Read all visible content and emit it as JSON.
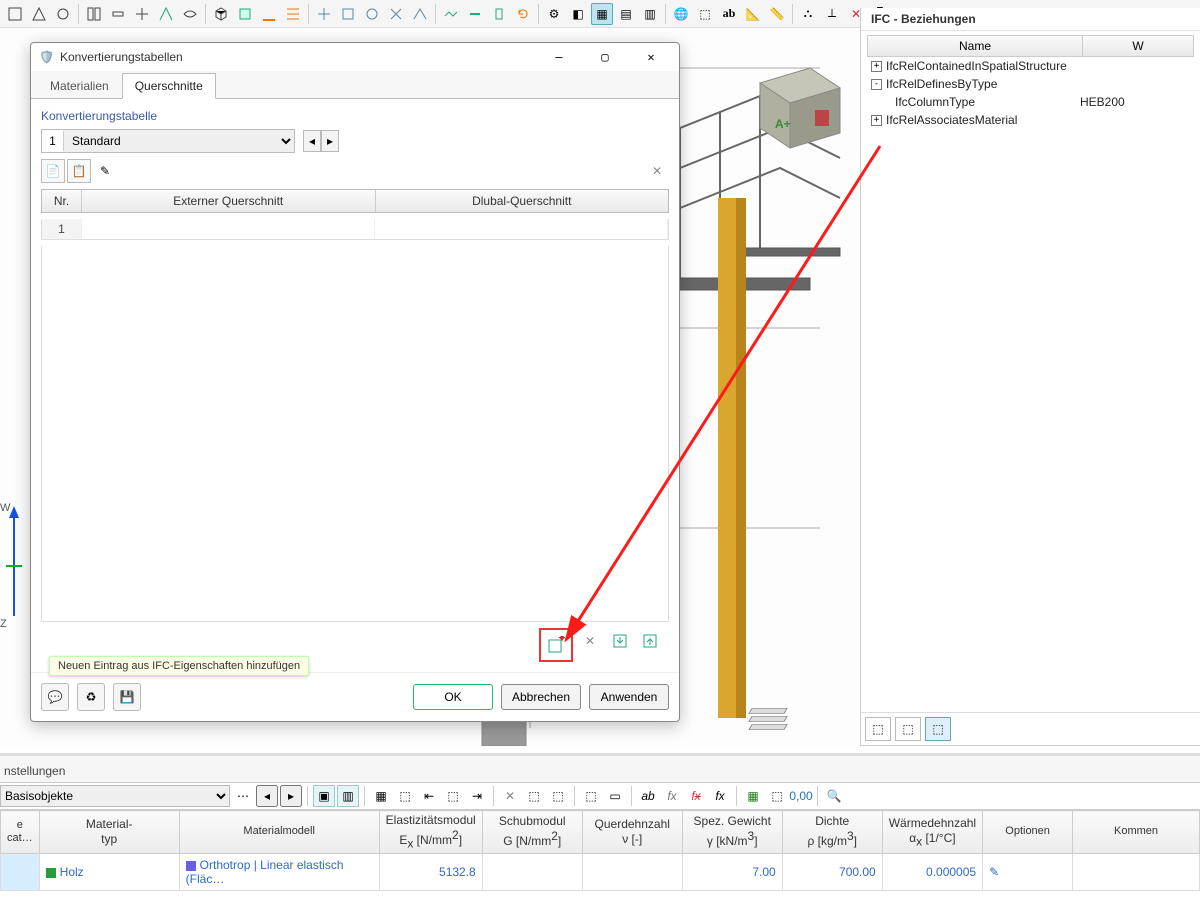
{
  "dialog": {
    "title": "Konvertierungstabellen",
    "tabs": [
      "Materialien",
      "Querschnitte"
    ],
    "active_tab": 1,
    "section_label": "Konvertierungstabelle",
    "selector": {
      "number": "1",
      "value": "Standard"
    },
    "columns": {
      "nr": "Nr.",
      "ext": "Externer Querschnitt",
      "dlubal": "Dlubal-Querschnitt"
    },
    "rows": [
      {
        "nr": "1",
        "ext": "",
        "dlubal": ""
      }
    ],
    "tooltip": "Neuen Eintrag aus IFC-Eigenschaften hinzufügen",
    "footer": {
      "ok": "OK",
      "cancel": "Abbrechen",
      "apply": "Anwenden"
    }
  },
  "ifc": {
    "title": "IFC - Beziehungen",
    "headers": {
      "name": "Name",
      "value": "W"
    },
    "tree": [
      {
        "exp": "+",
        "name": "IfcRelContainedInSpatialStructure",
        "value": ""
      },
      {
        "exp": "-",
        "name": "IfcRelDefinesByType",
        "value": ""
      },
      {
        "exp": "",
        "name": "IfcColumnType",
        "value": "HEB200",
        "indent": true
      },
      {
        "exp": "+",
        "name": "IfcRelAssociatesMaterial",
        "value": ""
      }
    ]
  },
  "axes": {
    "w": "W",
    "z": "Z"
  },
  "bottom": {
    "title": "nstellungen",
    "selector": "Basisobjekte",
    "headers": {
      "cat": "e cat…",
      "mattyp": [
        "Material-",
        "typ"
      ],
      "matmodell": "Materialmodell",
      "emod": [
        "Elastizitätsmodul",
        "E<sub>x</sub> [N/mm<sup>2</sup>]"
      ],
      "gmod": [
        "Schubmodul",
        "G [N/mm<sup>2</sup>]"
      ],
      "nu": [
        "Querdehnzahl",
        "ν [-]"
      ],
      "gamma": [
        "Spez. Gewicht",
        "γ [kN/m<sup>3</sup>]"
      ],
      "rho": [
        "Dichte",
        "ρ [kg/m<sup>3</sup>]"
      ],
      "alpha": [
        "Wärmedehnzahl",
        "α<sub>x</sub> [1/°C]"
      ],
      "opt": "Optionen",
      "komm": "Kommen"
    },
    "row": {
      "mattyp": "Holz",
      "matmodell": "Orthotrop | Linear elastisch (Fläc…",
      "emod": "5132.8",
      "gmod": "",
      "nu": "",
      "gamma": "7.00",
      "rho": "700.00",
      "alpha": "0.000005"
    }
  },
  "colors": {
    "holz": "#2a9a3a",
    "model": "#6a5fea"
  }
}
